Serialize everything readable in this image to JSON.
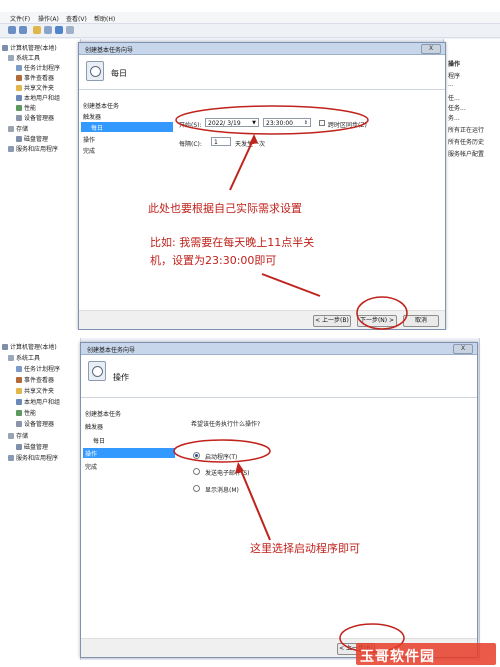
{
  "colors": {
    "accent": "#3399ff",
    "annotation": "#c0221c",
    "watermark": "#e83c28"
  },
  "menubar": {
    "file": "文件(F)",
    "action": "操作(A)",
    "view": "查看(V)",
    "help": "帮助(H)"
  },
  "tree": {
    "root": "计算机管理(本地)",
    "system_tools": "系统工具",
    "task_scheduler": "任务计划程序",
    "event_viewer": "事件查看器",
    "shared_folders": "共享文件夹",
    "local_users": "本地用户和组",
    "performance": "性能",
    "device_manager": "设备管理器",
    "storage": "存储",
    "disk_management": "磁盘管理",
    "services_apps": "服务和应用程序"
  },
  "actions_pane": {
    "header": "操作",
    "items": [
      "程序",
      "...",
      "任...",
      "任务...",
      "务...",
      "所有正在运行",
      "所有任务历史",
      "服务帐户配置"
    ]
  },
  "wizard1": {
    "title": "创建基本任务向导",
    "close": "X",
    "header_title": "每日",
    "steps": [
      "创建基本任务",
      "触发器",
      "每日",
      "操作",
      "完成"
    ],
    "selected_step": 2,
    "start_label": "开始(S):",
    "start_date": "2022/ 3/19",
    "start_time": "23:30:00",
    "sync_label": "跨时区同步(Z)",
    "every_label": "每隔(C):",
    "every_value": "1",
    "days_label": "天发生一次",
    "back": "< 上一步(B)",
    "next": "下一步(N) >",
    "cancel": "取消"
  },
  "wizard2": {
    "title": "创建基本任务向导",
    "close": "X",
    "header_title": "操作",
    "steps": [
      "创建基本任务",
      "触发器",
      "每日",
      "操作",
      "完成"
    ],
    "selected_step": 3,
    "question": "希望该任务执行什么操作?",
    "options": [
      "启动程序(T)",
      "发送电子邮件(S)",
      "显示消息(M)"
    ],
    "selected_option": 0,
    "back": "< 上一步(B)"
  },
  "annotations": {
    "note1_line1": "此处也要根据自己实际需求设置",
    "note1_line2": "比如: 我需要在每天晚上11点半关",
    "note1_line3": "机，设置为23:30:00即可",
    "note2": "这里选择启动程序即可"
  },
  "watermark": {
    "text": "玉哥软件园"
  }
}
